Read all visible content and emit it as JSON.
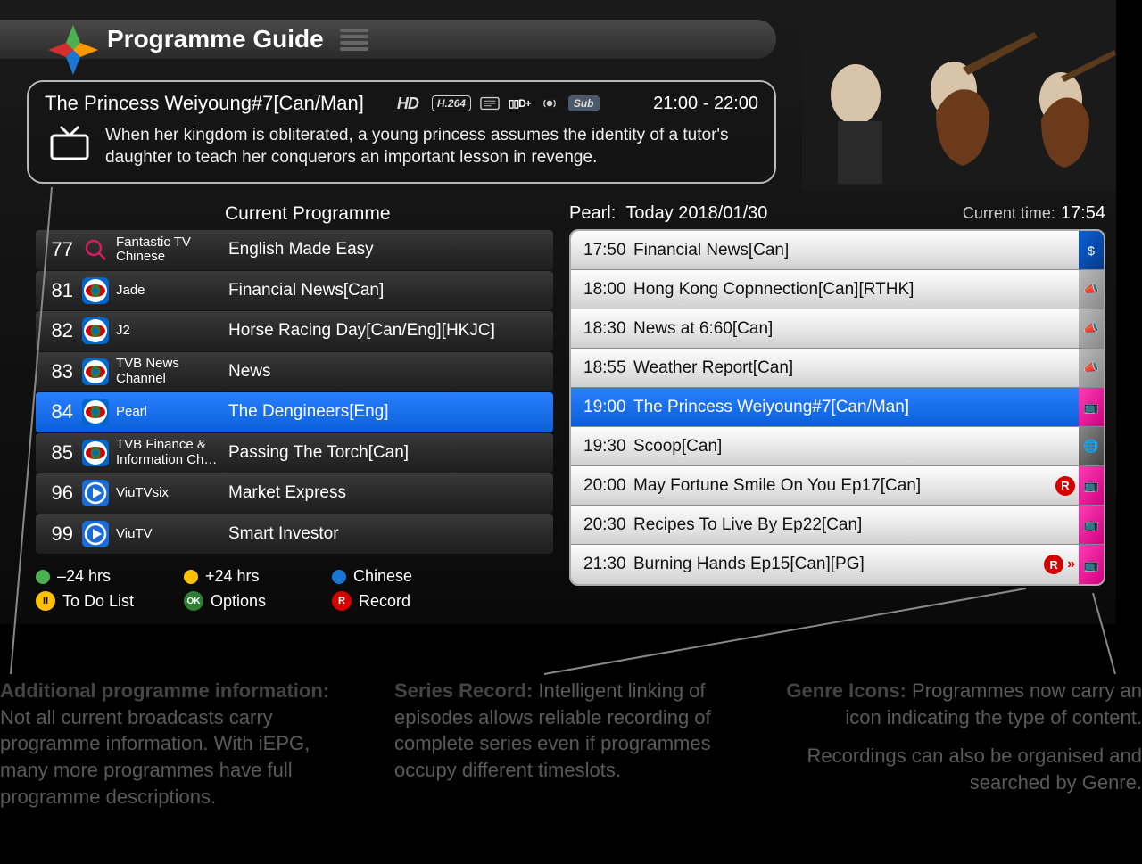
{
  "header": {
    "title": "Programme Guide"
  },
  "detail": {
    "title": "The Princess Weiyoung#7[Can/Man]",
    "badges": {
      "hd": "HD",
      "codec": "H.264",
      "dolby": "D+",
      "sub": "Sub"
    },
    "time": "21:00 - 22:00",
    "description": "When her kingdom is obliterated, a young princess assumes the identity of a tutor's daughter to teach her conquerors an important lesson in revenge."
  },
  "left": {
    "header": "Current Programme",
    "rows": [
      {
        "num": "77",
        "logo": "mag",
        "name": "Fantastic TV Chinese",
        "prog": "English Made Easy"
      },
      {
        "num": "81",
        "logo": "tvb",
        "name": "Jade",
        "prog": "Financial News[Can]"
      },
      {
        "num": "82",
        "logo": "tvb",
        "name": "J2",
        "prog": "Horse Racing Day[Can/Eng][HKJC]"
      },
      {
        "num": "83",
        "logo": "tvb",
        "name": "TVB News Channel",
        "prog": "News"
      },
      {
        "num": "84",
        "logo": "tvb",
        "name": "Pearl",
        "prog": "The Dengineers[Eng]",
        "selected": true
      },
      {
        "num": "85",
        "logo": "tvb",
        "name": "TVB Finance & Information Ch…",
        "prog": "Passing The Torch[Can]"
      },
      {
        "num": "96",
        "logo": "viu",
        "name": "ViuTVsix",
        "prog": "Market Express"
      },
      {
        "num": "99",
        "logo": "viu",
        "name": "ViuTV",
        "prog": "Smart Investor"
      }
    ]
  },
  "right": {
    "channel": "Pearl:",
    "date": "Today 2018/01/30",
    "current_time_label": "Current time:",
    "current_time": "17:54",
    "rows": [
      {
        "time": "17:50",
        "title": "Financial News[Can]",
        "genre": "blue",
        "glyph": "$"
      },
      {
        "time": "18:00",
        "title": "Hong Kong Copnnection[Can][RTHK]",
        "genre": "grey",
        "glyph": "📣"
      },
      {
        "time": "18:30",
        "title": "News at 6:60[Can]",
        "genre": "grey",
        "glyph": "📣"
      },
      {
        "time": "18:55",
        "title": "Weather Report[Can]",
        "genre": "grey",
        "glyph": "📣"
      },
      {
        "time": "19:00",
        "title": "The Princess Weiyoung#7[Can/Man]",
        "genre": "pink",
        "glyph": "📺",
        "selected": true
      },
      {
        "time": "19:30",
        "title": "Scoop[Can]",
        "genre": "globe",
        "glyph": "🌐"
      },
      {
        "time": "20:00",
        "title": "May Fortune Smile On You Ep17[Can]",
        "genre": "pink",
        "glyph": "📺",
        "mark": "R"
      },
      {
        "time": "20:30",
        "title": "Recipes To Live By Ep22[Can]",
        "genre": "pink",
        "glyph": "📺"
      },
      {
        "time": "21:30",
        "title": "Burning Hands Ep15[Can][PG]",
        "genre": "pink",
        "glyph": "📺",
        "mark": "R»"
      }
    ]
  },
  "legend": {
    "row1": [
      {
        "color": "green",
        "label": "–24 hrs"
      },
      {
        "color": "yellow",
        "label": "+24 hrs"
      },
      {
        "color": "blue",
        "label": "Chinese"
      }
    ],
    "row2": [
      {
        "pill": "y",
        "pill_text": "II",
        "label": "To Do List"
      },
      {
        "pill": "ok",
        "pill_text": "OK",
        "label": "Options"
      },
      {
        "pill": "r",
        "pill_text": "R",
        "label": "Record"
      }
    ]
  },
  "callouts": {
    "c1_bold": "Additional programme information:",
    "c1_text": " Not all current broadcasts carry programme information. With iEPG, many more programmes have full programme descriptions.",
    "c2_bold": "Series Record:",
    "c2_text": " Intelligent linking of episodes allows reliable recording of complete series even if programmes occupy different timeslots.",
    "c3_bold": "Genre Icons:",
    "c3_text": " Programmes now carry an icon indicating the type of content.",
    "c3_sub": "Recordings can also be organised and searched by Genre."
  }
}
